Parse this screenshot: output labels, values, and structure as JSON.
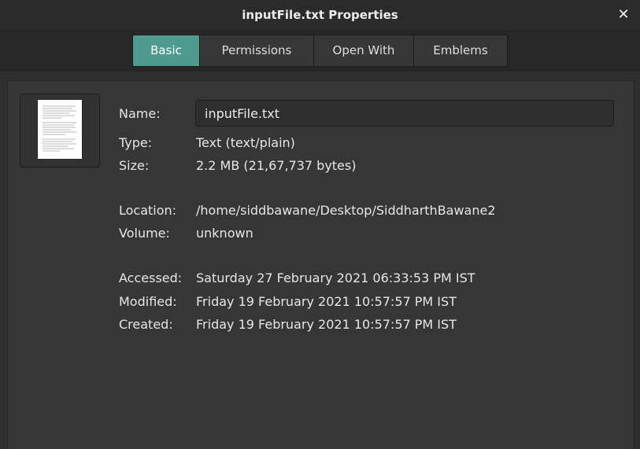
{
  "window": {
    "title": "inputFile.txt Properties",
    "close_label": "✕"
  },
  "tabs": [
    {
      "label": "Basic",
      "active": true
    },
    {
      "label": "Permissions",
      "active": false
    },
    {
      "label": "Open With",
      "active": false
    },
    {
      "label": "Emblems",
      "active": false
    }
  ],
  "basic": {
    "name_label": "Name:",
    "name_value": "inputFile.txt",
    "type_label": "Type:",
    "type_value": "Text (text/plain)",
    "size_label": "Size:",
    "size_value": "2.2 MB (21,67,737 bytes)",
    "location_label": "Location:",
    "location_value": "/home/siddbawane/Desktop/SiddharthBawane2",
    "volume_label": "Volume:",
    "volume_value": "unknown",
    "accessed_label": "Accessed:",
    "accessed_value": "Saturday 27 February 2021 06:33:53 PM IST",
    "modified_label": "Modified:",
    "modified_value": "Friday 19 February 2021 10:57:57 PM IST",
    "created_label": "Created:",
    "created_value": "Friday 19 February 2021 10:57:57 PM IST"
  },
  "icons": {
    "file": "text-document-icon",
    "close": "close-icon"
  },
  "colors": {
    "accent": "#4e9a8f",
    "background": "#363636",
    "text": "#e6e6e6"
  }
}
